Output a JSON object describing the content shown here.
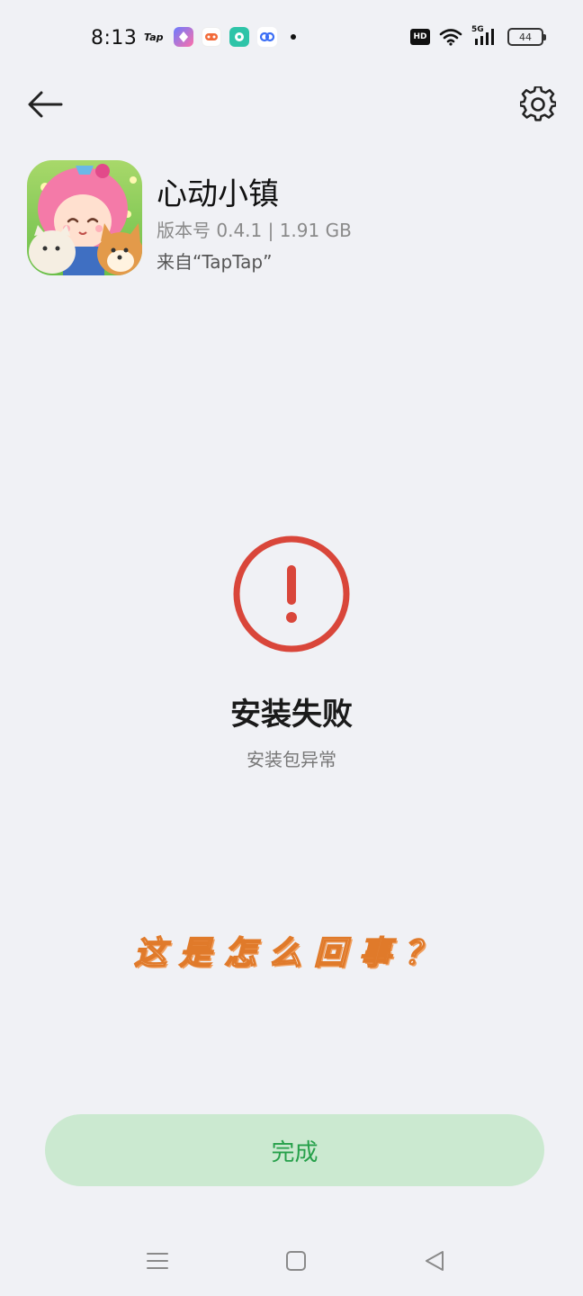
{
  "status_bar": {
    "time": "8:13",
    "tap_logo_text": "Tap",
    "network": "5G",
    "hd": "HD",
    "battery": "44"
  },
  "nav": {
    "back_icon": "arrow-left-icon",
    "settings_icon": "gear-icon"
  },
  "app": {
    "name": "心动小镇",
    "version": "版本号 0.4.1 | 1.91 GB",
    "source": "来自“TapTap”"
  },
  "result": {
    "icon": "exclamation-circle-icon",
    "title": "安装失败",
    "subtitle": "安装包异常",
    "accent": "#d9463a"
  },
  "caption": "这是怎么回事？",
  "done_button": {
    "label": "完成",
    "bg": "#cbe9d0",
    "fg": "#26a04a"
  },
  "system_nav": {
    "menu_icon": "menu-icon",
    "home_icon": "home-square-icon",
    "back_icon": "triangle-back-icon"
  }
}
